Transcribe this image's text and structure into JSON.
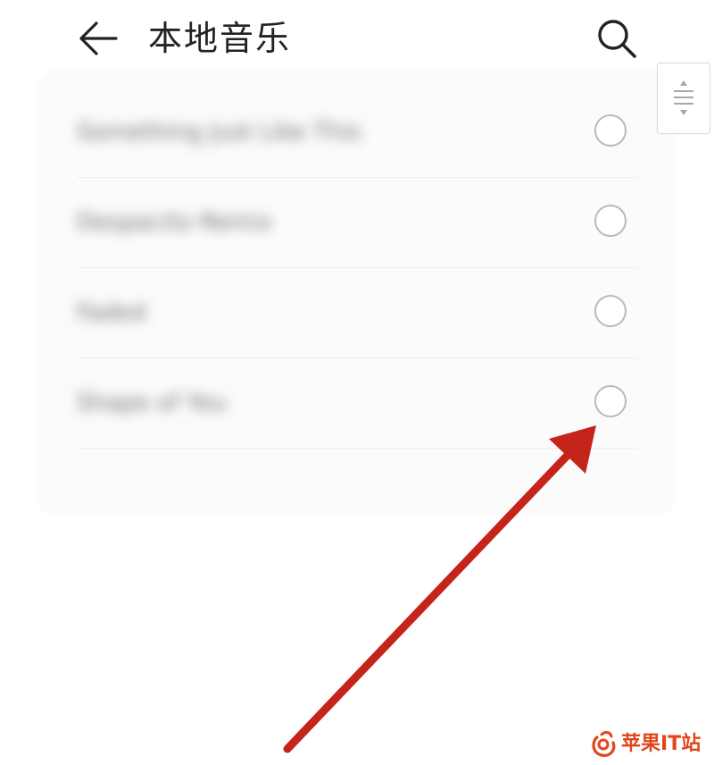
{
  "header": {
    "title": "本地音乐",
    "back_icon": "arrow-left-icon",
    "search_icon": "search-icon"
  },
  "list": {
    "items": [
      {
        "title": "Something Just Like This",
        "selected": false
      },
      {
        "title": "Despacito Remix",
        "selected": false
      },
      {
        "title": "Faded",
        "selected": false
      },
      {
        "title": "Shape of You",
        "selected": false
      }
    ]
  },
  "scroll_handle": {
    "icon": "drag-handle-icon"
  },
  "annotation": {
    "icon": "red-arrow-icon",
    "color": "#c5241b"
  },
  "watermark": {
    "text": "苹果IT站",
    "icon": "logo-icon",
    "color": "#e2451b"
  }
}
